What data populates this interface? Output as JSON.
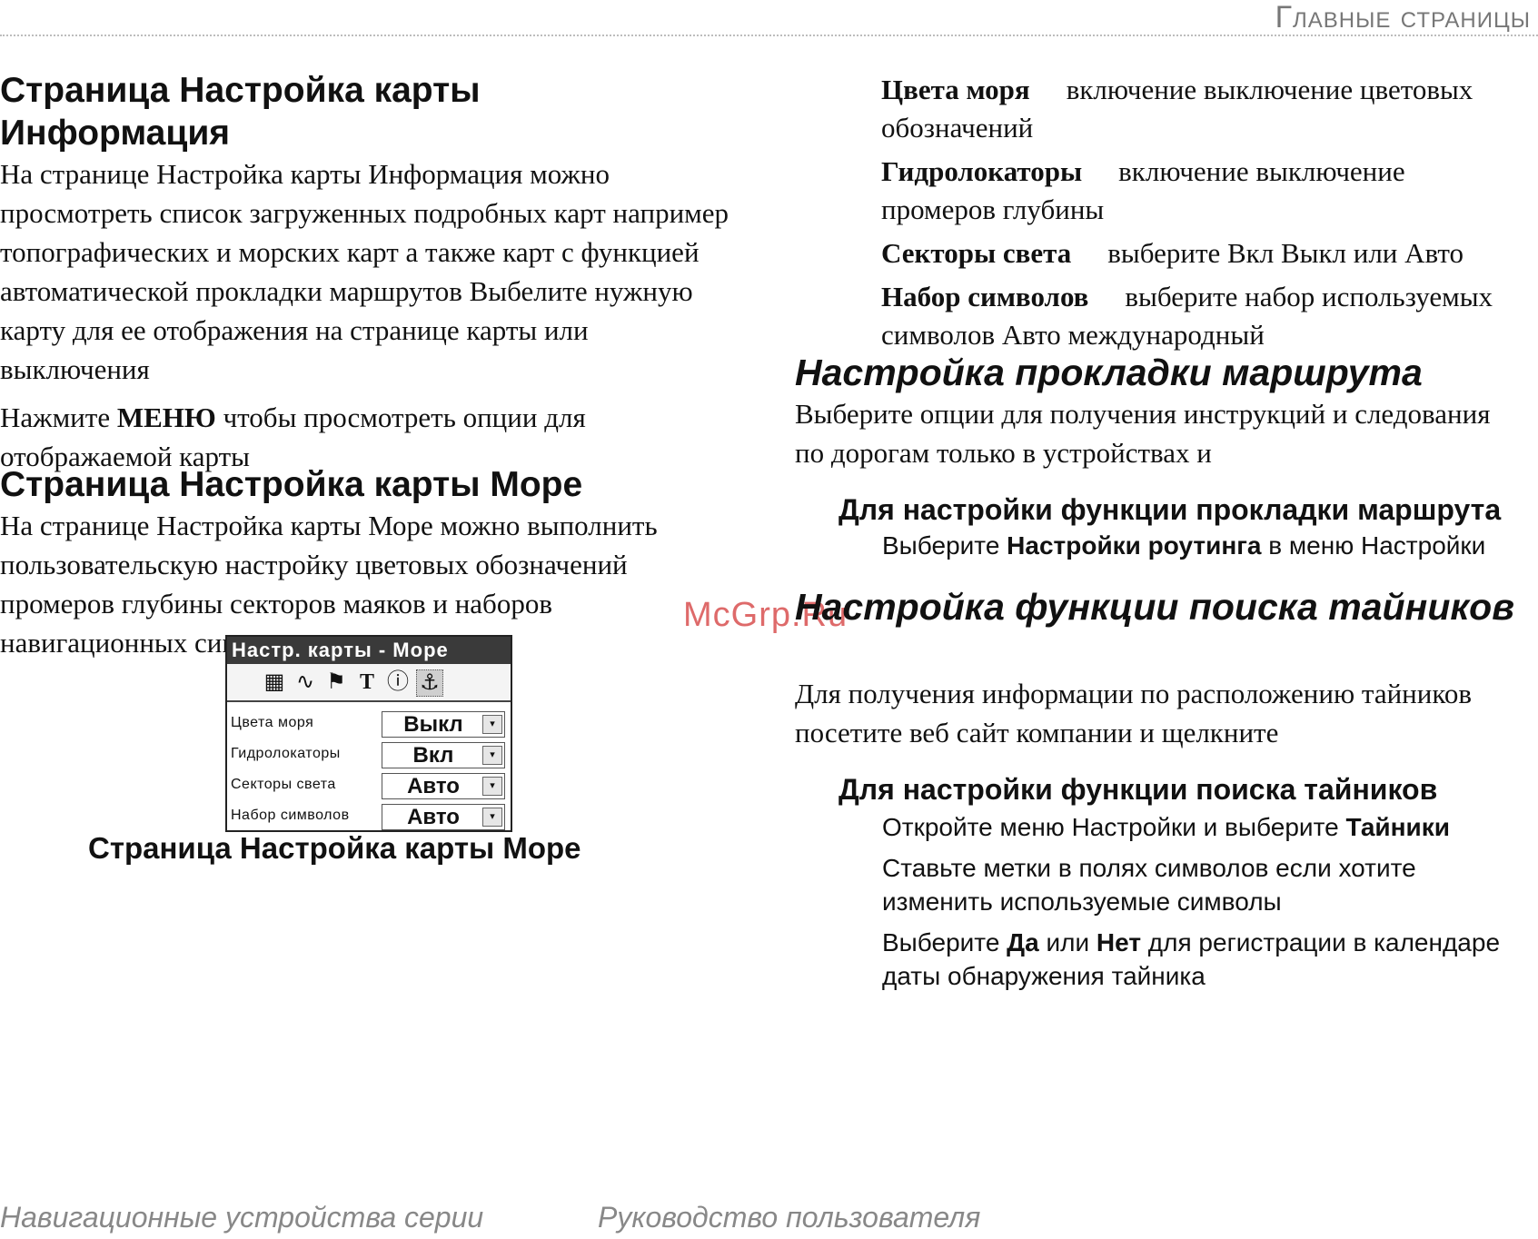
{
  "header": {
    "running_head": "Главные страницы"
  },
  "left": {
    "info_title_line1": "Страница   Настройка карты",
    "info_title_line2": "Информация",
    "info_par1": "На странице   Настройка карты    Информация   можно просмотреть список загруженных подробных карт  например топографических и морских карт  а также карт с функцией автоматической прокладки маршрутов  Выбелите нужную карту для ее отображения на странице карты или выключения",
    "info_par2_pre": "Нажмите ",
    "info_par2_bold": "МЕНЮ",
    "info_par2_post": "  чтобы просмотреть опции для отображаемой карты",
    "sea_title": "Страница   Настройка карты    Море",
    "sea_par": "На странице   Настройка карты    Море   можно выполнить пользовательскую настройку цветовых обозначений  промеров глубины  секторов маяков и наборов навигационных символов",
    "caption": "Страница   Настройка карты    Море"
  },
  "device": {
    "title": "Настр. карты - Море",
    "icons": [
      "map-icon",
      "route-icon",
      "flag-icon",
      "text-icon",
      "info-icon",
      "anchor-icon"
    ],
    "icon_glyphs": [
      "▦",
      "∿",
      "⚑",
      "T",
      "ⓘ",
      "⚓"
    ],
    "rows": [
      {
        "label": "Цвета моря",
        "value": "Выкл"
      },
      {
        "label": "Гидролокаторы",
        "value": "Вкл"
      },
      {
        "label": "Секторы света",
        "value": "Авто"
      },
      {
        "label": "Набор символов",
        "value": "Авто"
      }
    ],
    "arrow": "▾"
  },
  "right": {
    "defs": [
      {
        "term": "Цвета моря",
        "desc": "включение выключение цветовых обозначений"
      },
      {
        "term": "Гидролокаторы",
        "desc": "включение выключение промеров глубины"
      },
      {
        "term": "Секторы света",
        "desc": "выберите Вкл   Выкл  или Авто"
      },
      {
        "term": "Набор символов",
        "desc": "выберите набор используемых символов  Авто                              международный"
      }
    ],
    "route_title": "Настройка прокладки маршрута",
    "route_par": "Выберите опции для получения инструкций и следования по дорогам   только в устройствах                  и",
    "route_sub": "Для настройки функции прокладки маршрута",
    "route_step_pre": "Выберите ",
    "route_step_bold": "Настройки роутинга",
    "route_step_post": " в меню  Настройки",
    "cache_title": "Настройка функции поиска тайников",
    "cache_par": "Для получения информации по расположению тайников посетите веб сайт компании                                              и щелкните",
    "cache_sub": "Для настройки функции поиска тайников",
    "cache_step1_pre": "Откройте меню  Настройки  и выберите ",
    "cache_step1_bold": "Тайники",
    "cache_step2": "Ставьте метки в полях символов  если хотите изменить используемые символы",
    "cache_step3_a": "Выберите ",
    "cache_step3_b": "Да",
    "cache_step3_c": " или ",
    "cache_step3_d": "Нет",
    "cache_step3_e": " для регистрации в календаре даты обнаружения тайника"
  },
  "watermark": "McGrp.Ru",
  "footer": {
    "left": "Навигационные устройства серии",
    "right": "Руководство пользователя"
  }
}
